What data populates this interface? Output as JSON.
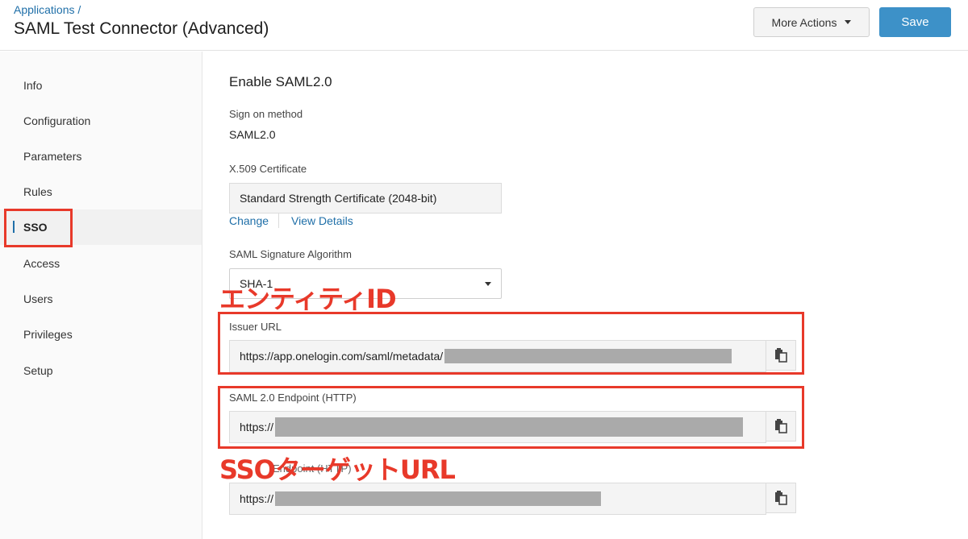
{
  "header": {
    "breadcrumb": "Applications /",
    "title": "SAML Test Connector (Advanced)",
    "more_actions_label": "More Actions",
    "save_label": "Save"
  },
  "sidebar": {
    "items": [
      {
        "label": "Info"
      },
      {
        "label": "Configuration"
      },
      {
        "label": "Parameters"
      },
      {
        "label": "Rules"
      },
      {
        "label": "SSO",
        "active": true
      },
      {
        "label": "Access"
      },
      {
        "label": "Users"
      },
      {
        "label": "Privileges"
      },
      {
        "label": "Setup"
      }
    ]
  },
  "main": {
    "section_title": "Enable SAML2.0",
    "sign_on_method_label": "Sign on method",
    "sign_on_method_value": "SAML2.0",
    "certificate_label": "X.509 Certificate",
    "certificate_value": "Standard Strength Certificate (2048-bit)",
    "change_link": "Change",
    "view_details_link": "View Details",
    "signature_algorithm_label": "SAML Signature Algorithm",
    "signature_algorithm_value": "SHA-1",
    "issuer_url_label": "Issuer URL",
    "issuer_url_value": "https://app.onelogin.com/saml/metadata/",
    "saml_endpoint_label": "SAML 2.0 Endpoint (HTTP)",
    "saml_endpoint_value": "https://",
    "slo_endpoint_label_partial": "Endpoint (HTTP)",
    "slo_endpoint_value": "https://"
  },
  "annotations": {
    "entity_id": "エンティティID",
    "sso_target_url": "SSOターゲットURL"
  },
  "colors": {
    "accent": "#1f6fa8",
    "save_button": "#3d91c8",
    "annotation_red": "#e8392a",
    "redaction_gray": "#aaaaaa"
  }
}
